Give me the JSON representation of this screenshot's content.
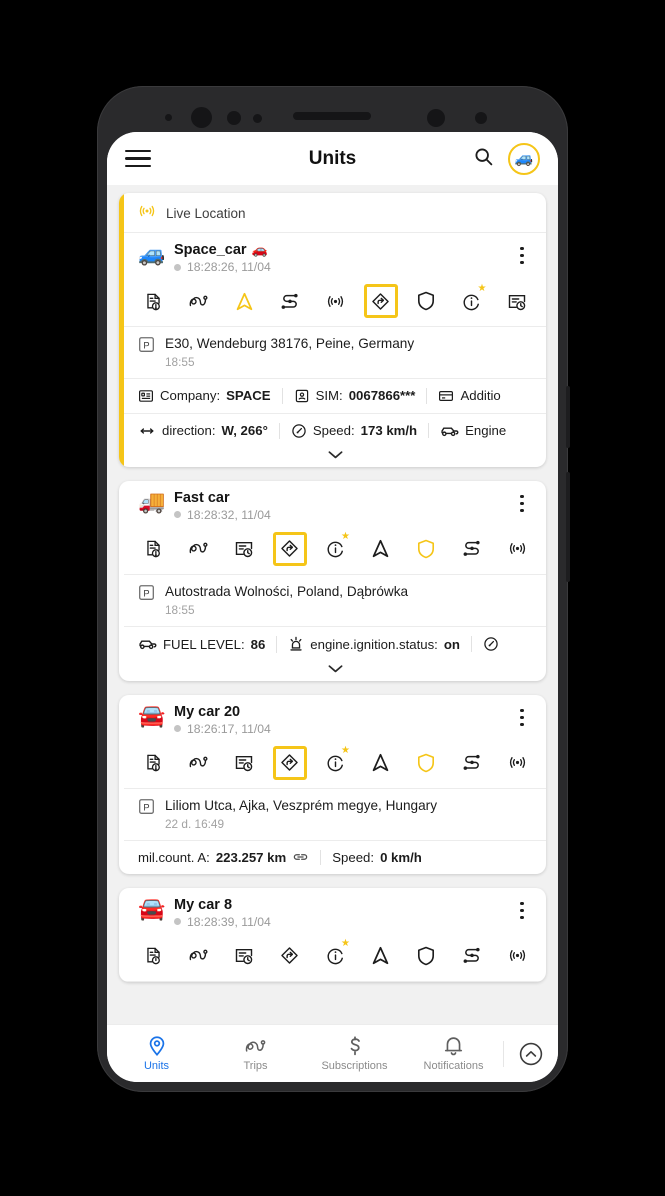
{
  "header": {
    "menu_icon": "hamburger-menu-icon",
    "title": "Units",
    "search_icon": "search-icon",
    "avatar_icon": "car-avatar-icon",
    "avatar_emoji": "🚙",
    "accent_color": "#f5c518"
  },
  "live_location": {
    "icon": "live-signal-icon",
    "label": "Live Location"
  },
  "cards": [
    {
      "emoji": "🚙",
      "name": "Space_car",
      "name_badge_emoji": "🚗",
      "timestamp": "18:28:26, 11/04",
      "status_color": "#c4c4c4",
      "accent": true,
      "has_live_header": true,
      "icons": [
        {
          "name": "report-icon",
          "selected": false,
          "color": "#1d1d1d",
          "star": false
        },
        {
          "name": "trips-route-icon",
          "selected": false,
          "color": "#1d1d1d",
          "star": false
        },
        {
          "name": "navigation-arrow-icon",
          "selected": false,
          "color": "#f5c518",
          "star": false
        },
        {
          "name": "route-plan-icon",
          "selected": false,
          "color": "#1d1d1d",
          "star": false
        },
        {
          "name": "live-signal-icon",
          "selected": false,
          "color": "#1d1d1d",
          "star": false
        },
        {
          "name": "directions-icon",
          "selected": true,
          "color": "#1d1d1d",
          "star": false
        },
        {
          "name": "shield-icon",
          "selected": false,
          "color": "#1d1d1d",
          "star": false
        },
        {
          "name": "info-icon",
          "selected": false,
          "color": "#1d1d1d",
          "star": true
        },
        {
          "name": "history-icon",
          "selected": false,
          "color": "#1d1d1d",
          "star": false
        }
      ],
      "address": "E30, Wendeburg 38176, Peine, Germany",
      "address_time": "18:55",
      "meta_rows": [
        [
          {
            "icon": "company-icon",
            "label": "Company:",
            "value": "SPACE"
          },
          {
            "icon": "sim-card-icon",
            "label": "SIM:",
            "value": "0067866***"
          },
          {
            "icon": "credit-card-icon",
            "label": "Additio",
            "value": ""
          }
        ],
        [
          {
            "icon": "direction-arrow-icon",
            "label": "direction:",
            "value": "W, 266°"
          },
          {
            "icon": "speedometer-icon",
            "label": "Speed:",
            "value": "173 km/h"
          },
          {
            "icon": "car-icon",
            "label": "Engine",
            "value": ""
          }
        ]
      ],
      "expand_chevron": true
    },
    {
      "emoji": "🚚",
      "name": "Fast car",
      "name_badge_emoji": "",
      "timestamp": "18:28:32, 11/04",
      "status_color": "#c4c4c4",
      "accent": false,
      "has_live_header": false,
      "icons": [
        {
          "name": "report-icon",
          "selected": false,
          "color": "#1d1d1d",
          "star": false
        },
        {
          "name": "trips-route-icon",
          "selected": false,
          "color": "#1d1d1d",
          "star": false
        },
        {
          "name": "history-icon",
          "selected": false,
          "color": "#1d1d1d",
          "star": false
        },
        {
          "name": "directions-icon",
          "selected": true,
          "color": "#1d1d1d",
          "star": false
        },
        {
          "name": "info-icon",
          "selected": false,
          "color": "#1d1d1d",
          "star": true
        },
        {
          "name": "navigation-arrow-icon",
          "selected": false,
          "color": "#1d1d1d",
          "star": false
        },
        {
          "name": "shield-icon",
          "selected": false,
          "color": "#f5c518",
          "star": false
        },
        {
          "name": "route-plan-icon",
          "selected": false,
          "color": "#1d1d1d",
          "star": false
        },
        {
          "name": "live-signal-icon",
          "selected": false,
          "color": "#1d1d1d",
          "star": false
        }
      ],
      "address": "Autostrada Wolności, Poland, Dąbrówka",
      "address_time": "18:55",
      "meta_rows": [
        [
          {
            "icon": "car-icon",
            "label": "FUEL LEVEL:",
            "value": "86"
          },
          {
            "icon": "ignition-icon",
            "label": "engine.ignition.status:",
            "value": "on"
          },
          {
            "icon": "speedometer-icon",
            "label": "",
            "value": ""
          }
        ]
      ],
      "expand_chevron": true
    },
    {
      "emoji": "🚘",
      "name": "My car 20",
      "name_badge_emoji": "",
      "timestamp": "18:26:17, 11/04",
      "status_color": "#c4c4c4",
      "accent": false,
      "has_live_header": false,
      "icons": [
        {
          "name": "report-icon",
          "selected": false,
          "color": "#1d1d1d",
          "star": false
        },
        {
          "name": "trips-route-icon",
          "selected": false,
          "color": "#1d1d1d",
          "star": false
        },
        {
          "name": "history-icon",
          "selected": false,
          "color": "#1d1d1d",
          "star": false
        },
        {
          "name": "directions-icon",
          "selected": true,
          "color": "#1d1d1d",
          "star": false
        },
        {
          "name": "info-icon",
          "selected": false,
          "color": "#1d1d1d",
          "star": true
        },
        {
          "name": "navigation-arrow-icon",
          "selected": false,
          "color": "#1d1d1d",
          "star": false
        },
        {
          "name": "shield-icon",
          "selected": false,
          "color": "#f5c518",
          "star": false
        },
        {
          "name": "route-plan-icon",
          "selected": false,
          "color": "#1d1d1d",
          "star": false
        },
        {
          "name": "live-signal-icon",
          "selected": false,
          "color": "#1d1d1d",
          "star": false
        }
      ],
      "address": "Liliom Utca, Ajka, Veszprém megye, Hungary",
      "address_time": "22 d. 16:49",
      "meta_rows": [
        [
          {
            "icon": "",
            "label": "mil.count. A:",
            "value": "223.257 km",
            "trailing_icon": "link-icon"
          },
          {
            "icon": "",
            "label": "Speed:",
            "value": "0 km/h"
          }
        ]
      ],
      "expand_chevron": false
    },
    {
      "emoji": "🚘",
      "name": "My car 8",
      "name_badge_emoji": "",
      "timestamp": "18:28:39, 11/04",
      "status_color": "#c4c4c4",
      "accent": false,
      "has_live_header": false,
      "icons": [
        {
          "name": "report-icon",
          "selected": false,
          "color": "#1d1d1d",
          "star": false
        },
        {
          "name": "trips-route-icon",
          "selected": false,
          "color": "#1d1d1d",
          "star": false
        },
        {
          "name": "history-icon",
          "selected": false,
          "color": "#1d1d1d",
          "star": false
        },
        {
          "name": "directions-icon",
          "selected": false,
          "color": "#1d1d1d",
          "star": false
        },
        {
          "name": "info-icon",
          "selected": false,
          "color": "#1d1d1d",
          "star": true
        },
        {
          "name": "navigation-arrow-icon",
          "selected": false,
          "color": "#1d1d1d",
          "star": false
        },
        {
          "name": "shield-icon",
          "selected": false,
          "color": "#1d1d1d",
          "star": false
        },
        {
          "name": "route-plan-icon",
          "selected": false,
          "color": "#1d1d1d",
          "star": false
        },
        {
          "name": "live-signal-icon",
          "selected": false,
          "color": "#1d1d1d",
          "star": false
        }
      ],
      "address": "",
      "address_time": "",
      "meta_rows": [],
      "expand_chevron": false
    }
  ],
  "bottom_nav": {
    "active_color": "#1a73e8",
    "items": [
      {
        "icon": "location-pin-icon",
        "label": "Units",
        "active": true
      },
      {
        "icon": "trips-route-icon",
        "label": "Trips",
        "active": false
      },
      {
        "icon": "dollar-icon",
        "label": "Subscriptions",
        "active": false
      },
      {
        "icon": "bell-icon",
        "label": "Notifications",
        "active": false
      }
    ],
    "collapse_icon": "chevron-up-circle-icon"
  }
}
